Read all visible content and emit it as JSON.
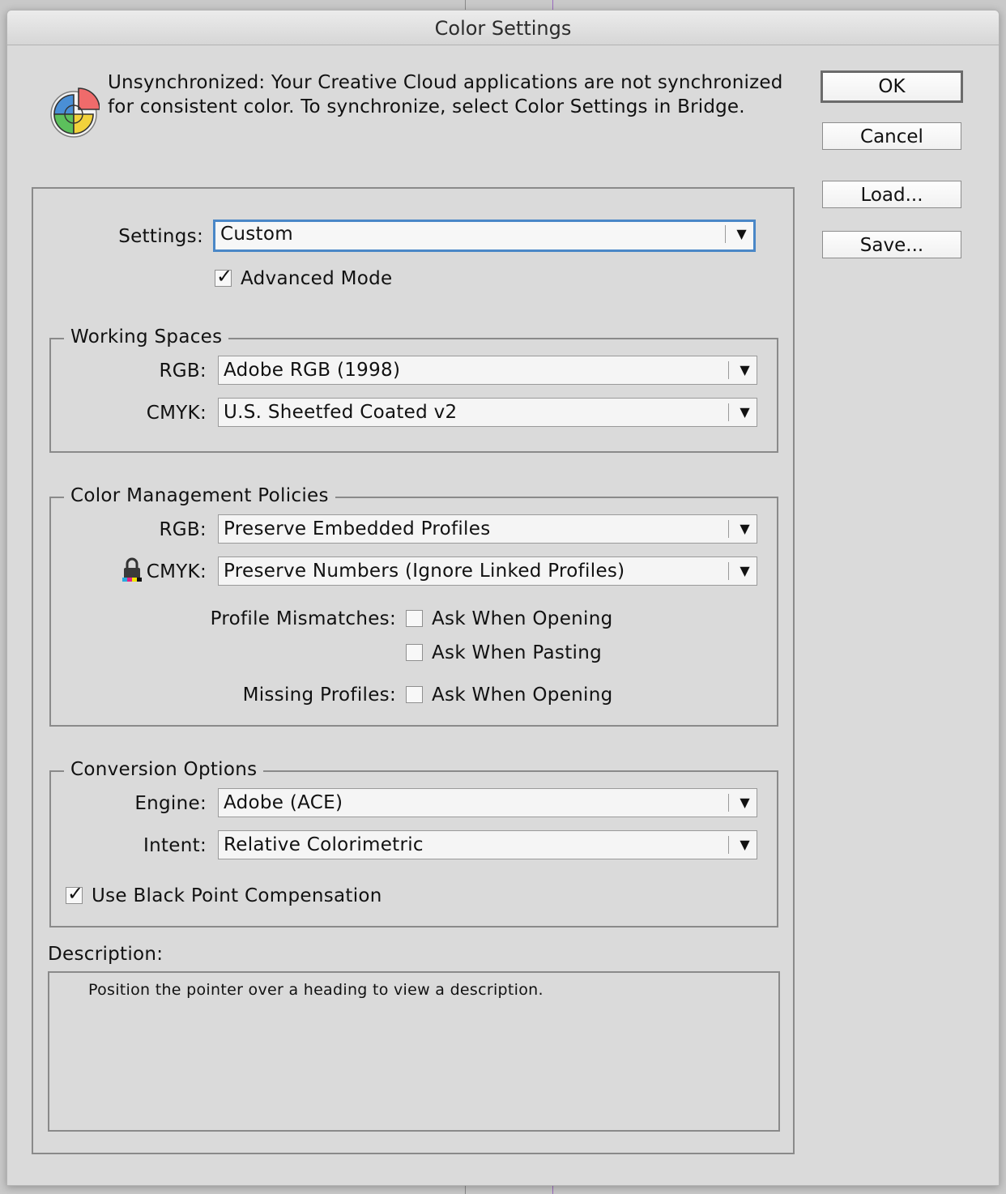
{
  "window": {
    "title": "Color Settings"
  },
  "sync_message": "Unsynchronized: Your Creative Cloud applications are not synchronized for consistent color. To synchronize, select Color Settings in Bridge.",
  "buttons": {
    "ok": "OK",
    "cancel": "Cancel",
    "load": "Load...",
    "save": "Save..."
  },
  "settings": {
    "label": "Settings:",
    "value": "Custom",
    "advanced_mode_label": "Advanced Mode",
    "advanced_mode_checked": true
  },
  "working_spaces": {
    "title": "Working Spaces",
    "rgb_label": "RGB:",
    "rgb_value": "Adobe RGB (1998)",
    "cmyk_label": "CMYK:",
    "cmyk_value": "U.S. Sheetfed Coated v2"
  },
  "policies": {
    "title": "Color Management Policies",
    "rgb_label": "RGB:",
    "rgb_value": "Preserve Embedded Profiles",
    "cmyk_label": "CMYK:",
    "cmyk_value": "Preserve Numbers (Ignore Linked Profiles)",
    "profile_mismatches_label": "Profile Mismatches:",
    "ask_when_opening_label": "Ask When Opening",
    "ask_when_pasting_label": "Ask When Pasting",
    "missing_profiles_label": "Missing Profiles:",
    "missing_ask_when_opening_label": "Ask When Opening"
  },
  "conversion": {
    "title": "Conversion Options",
    "engine_label": "Engine:",
    "engine_value": "Adobe (ACE)",
    "intent_label": "Intent:",
    "intent_value": "Relative Colorimetric",
    "black_point_label": "Use Black Point Compensation",
    "black_point_checked": true
  },
  "description": {
    "label": "Description:",
    "text": "Position the pointer over a heading to view a description."
  },
  "colors": {
    "focus_ring": "#4a87c7",
    "dialog_bg": "#dadada"
  },
  "icons": {
    "app": "color-wheel-icon",
    "lock": "lock-icon",
    "dropdown": "chevron-down-icon",
    "check": "checkmark-icon"
  }
}
